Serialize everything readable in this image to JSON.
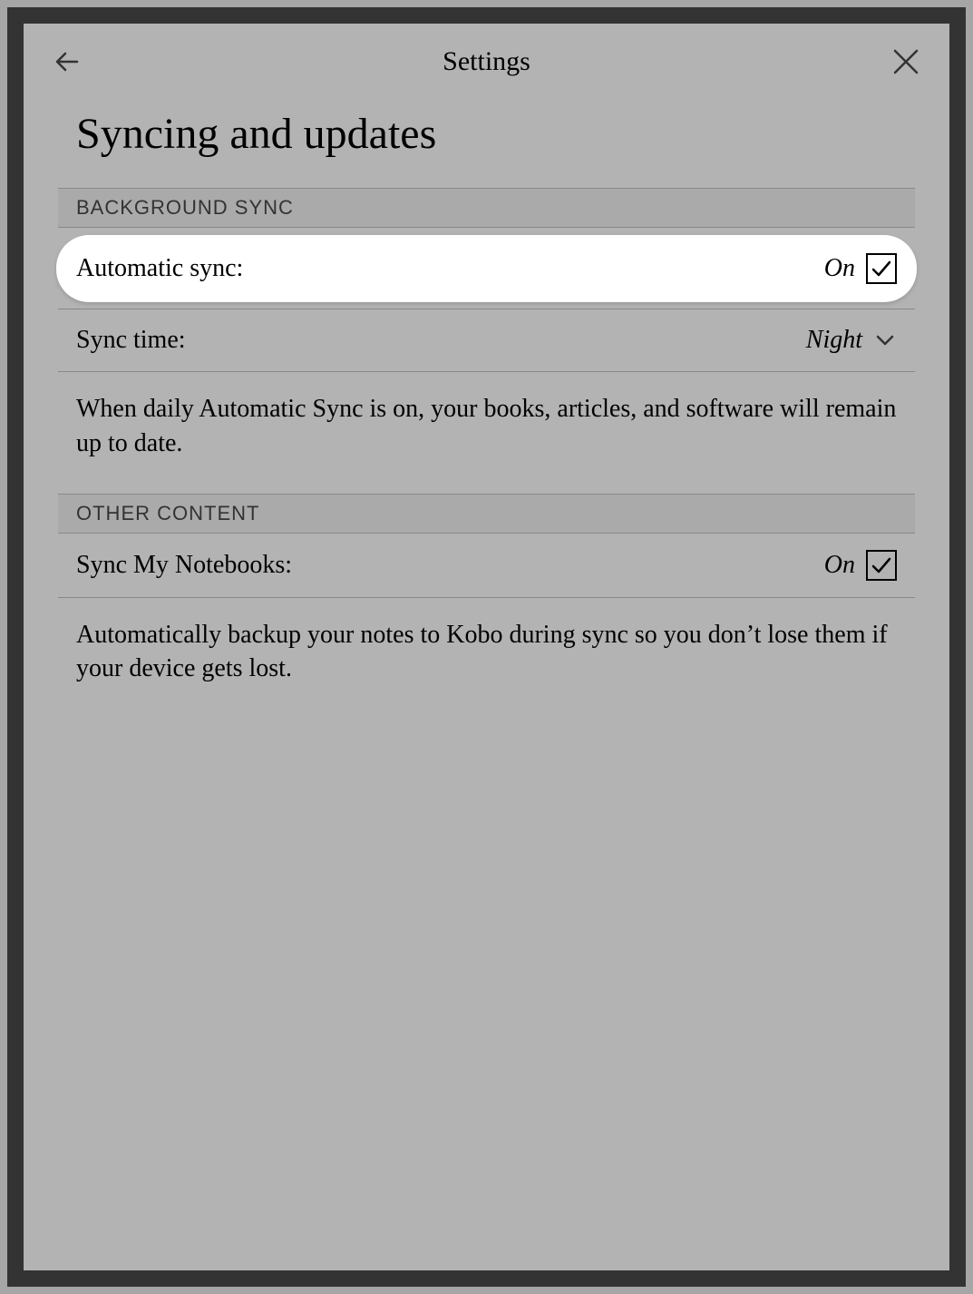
{
  "header": {
    "title": "Settings"
  },
  "page": {
    "title": "Syncing and updates"
  },
  "section_background_sync": {
    "header": "BACKGROUND SYNC",
    "auto_sync": {
      "label": "Automatic sync:",
      "state": "On"
    },
    "sync_time": {
      "label": "Sync time:",
      "value": "Night"
    },
    "description": "When daily Automatic Sync is on, your books, articles, and software will remain up to date."
  },
  "section_other_content": {
    "header": "OTHER CONTENT",
    "sync_notebooks": {
      "label": "Sync My Notebooks:",
      "state": "On"
    },
    "description": "Automatically backup your notes to Kobo during sync so you don’t lose them if your device gets lost."
  }
}
